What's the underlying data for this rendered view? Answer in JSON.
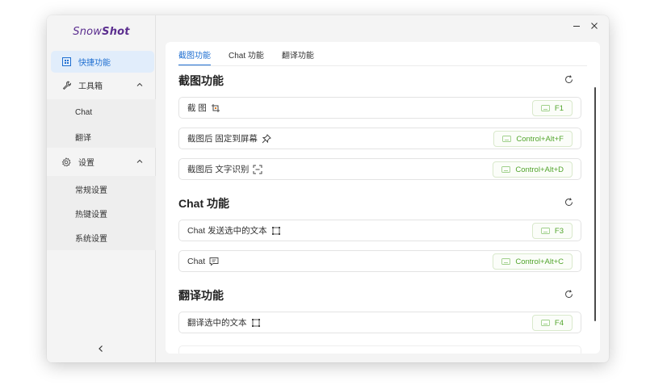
{
  "app": {
    "logo_part1": "Snow",
    "logo_part2": "Shot"
  },
  "window_controls": {
    "minimize_icon": "minimize-icon",
    "close_icon": "close-icon"
  },
  "sidebar": {
    "items": [
      {
        "label": "快捷功能",
        "icon": "shortcut-grid-icon",
        "active": true
      },
      {
        "label": "工具箱",
        "icon": "wrench-icon",
        "expanded": true
      },
      {
        "label": "Chat"
      },
      {
        "label": "翻译"
      },
      {
        "label": "设置",
        "icon": "gear-icon",
        "expanded": true
      },
      {
        "label": "常规设置"
      },
      {
        "label": "热键设置"
      },
      {
        "label": "系统设置"
      }
    ],
    "collapse_icon": "chevron-left-icon"
  },
  "tabs": [
    "截图功能",
    "Chat 功能",
    "翻译功能"
  ],
  "sections": [
    {
      "title": "截图功能",
      "rows": [
        {
          "label": "截 图",
          "icon": "crop-icon",
          "hotkey": "F1"
        },
        {
          "label": "截图后 固定到屏幕",
          "icon": "pin-icon",
          "hotkey": "Control+Alt+F"
        },
        {
          "label": "截图后 文字识别",
          "icon": "scan-text-icon",
          "hotkey": "Control+Alt+D"
        }
      ]
    },
    {
      "title": "Chat 功能",
      "rows": [
        {
          "label": "Chat 发送选中的文本",
          "icon": "select-text-icon",
          "hotkey": "F3"
        },
        {
          "label": "Chat",
          "icon": "message-icon",
          "hotkey": "Control+Alt+C"
        }
      ]
    },
    {
      "title": "翻译功能",
      "rows": [
        {
          "label": "翻译选中的文本",
          "icon": "select-text-icon",
          "hotkey": "F4"
        }
      ]
    }
  ],
  "colors": {
    "accent": "#1f6fd1",
    "hotkey_green": "#52a52c",
    "logo_purple": "#5b2e8f"
  }
}
